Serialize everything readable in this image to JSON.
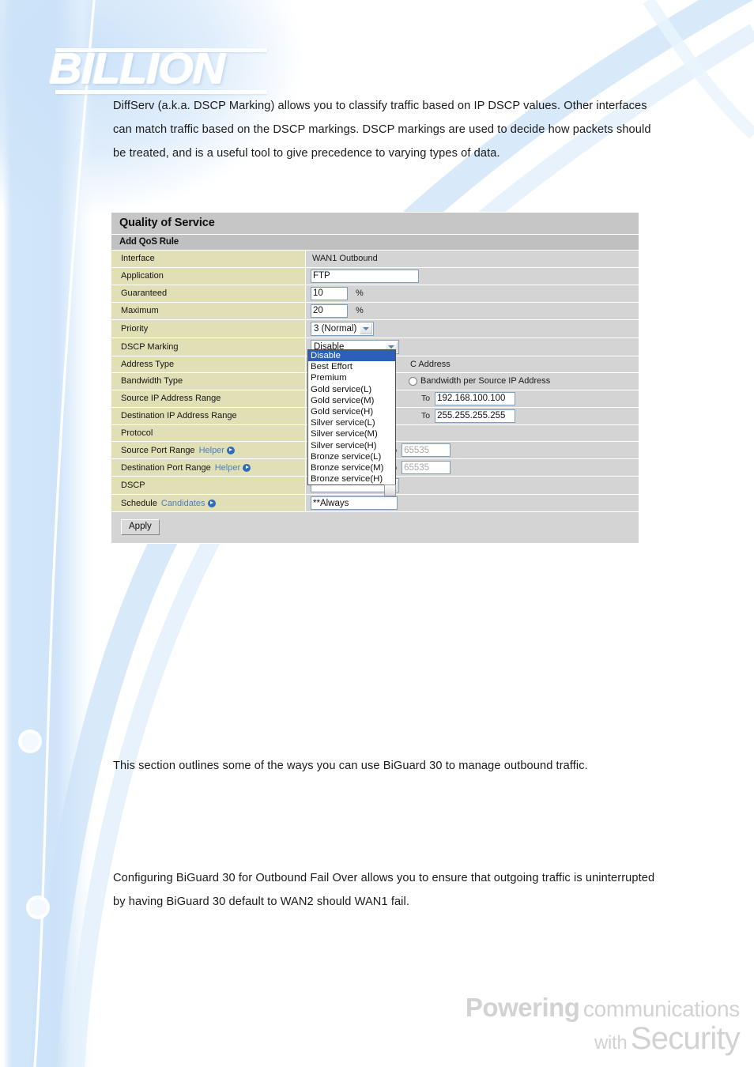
{
  "brand": {
    "logo_text": "BILLION",
    "tagline_line1_bold": "Powering",
    "tagline_line1_light": "communications",
    "tagline_line2_small": "with",
    "tagline_line2_big": "Security"
  },
  "paragraphs": {
    "intro": "DiffServ (a.k.a. DSCP Marking) allows you to classify traffic based on IP DSCP values. Other interfaces can match traffic based on the DSCP markings. DSCP markings are used to decide how packets should be treated, and is a useful tool to give precedence to varying types of data.",
    "outbound": "This section outlines some of the ways you can use BiGuard 30 to manage outbound traffic.",
    "failover": "Configuring BiGuard 30 for Outbound Fail Over allows you to ensure that outgoing traffic is uninterrupted by having BiGuard 30 default to WAN2 should WAN1 fail."
  },
  "qos": {
    "title": "Quality of Service",
    "subtitle": "Add QoS Rule",
    "rows": {
      "interface": {
        "label": "Interface",
        "value": "WAN1 Outbound"
      },
      "application": {
        "label": "Application",
        "value": "FTP"
      },
      "guaranteed": {
        "label": "Guaranteed",
        "value": "10",
        "unit": "%"
      },
      "maximum": {
        "label": "Maximum",
        "value": "20",
        "unit": "%"
      },
      "priority": {
        "label": "Priority",
        "value": "3 (Normal)"
      },
      "dscp_marking": {
        "label": "DSCP Marking",
        "value": "Disable"
      },
      "address_type": {
        "label": "Address Type",
        "option_partial": "C Address"
      },
      "bandwidth_type": {
        "label": "Bandwidth Type",
        "option2": "Bandwidth per Source IP Address"
      },
      "source_ip_range": {
        "label": "Source IP Address Range",
        "to_label": "To",
        "to_value": "192.168.100.100"
      },
      "dest_ip_range": {
        "label": "Destination IP Address Range",
        "to_label": "To",
        "to_value": "255.255.255.255"
      },
      "protocol": {
        "label": "Protocol"
      },
      "source_port_range": {
        "label": "Source Port Range",
        "helper": "Helper",
        "to_label": "To",
        "to_placeholder": "65535"
      },
      "dest_port_range": {
        "label": "Destination Port Range",
        "helper": "Helper",
        "to_label": "To",
        "to_placeholder": "65535"
      },
      "dscp": {
        "label": "DSCP"
      },
      "schedule": {
        "label": "Schedule",
        "candidates": "Candidates",
        "value": "**Always"
      }
    },
    "apply_label": "Apply",
    "dscp_dropdown_options": [
      "Disable",
      "Best Effort",
      "Premium",
      "Gold service(L)",
      "Gold service(M)",
      "Gold service(H)",
      "Silver service(L)",
      "Silver service(M)",
      "Silver service(H)",
      "Bronze service(L)",
      "Bronze service(M)",
      "Bronze service(H)"
    ],
    "dscp_selected_index": 0
  },
  "colors": {
    "label_cell": "#e0dfb5",
    "value_cell": "#d4d4d4",
    "title_bar": "#c6c6c6",
    "subtitle_bar": "#c0c0c0",
    "link_blue": "#4a7fc0",
    "dropdown_highlight": "#2b5fb8",
    "page_accent": "#cbe2f8"
  }
}
